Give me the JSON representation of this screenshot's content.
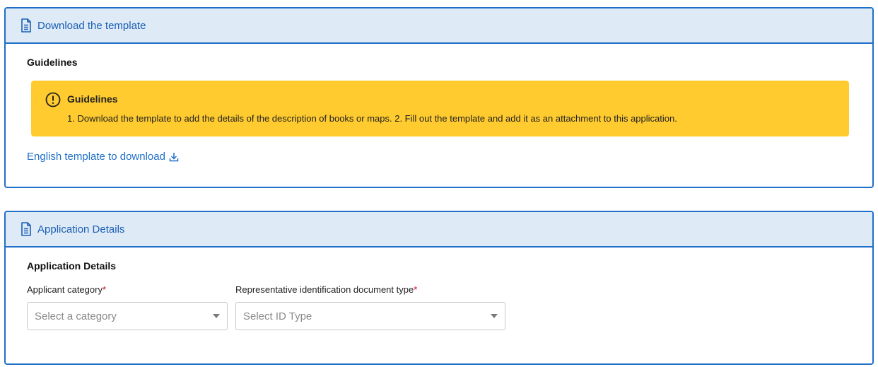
{
  "download_card": {
    "header_title": "Download the template",
    "header_icon": "document-icon",
    "section_title": "Guidelines",
    "alert": {
      "icon": "exclamation-circle-icon",
      "title": "Guidelines",
      "text": "1. Download the template to add the details of the description of books or maps. 2. Fill out the template and add it as an attachment to this application.",
      "color": "#ffcb2e"
    },
    "download_link": {
      "label": "English template to download",
      "icon": "download-icon"
    }
  },
  "application_card": {
    "header_title": "Application Details",
    "header_icon": "document-icon",
    "section_title": "Application Details",
    "fields": [
      {
        "label": "Applicant category",
        "required_mark": "*",
        "placeholder": "Select a category"
      },
      {
        "label": "Representative identification document type",
        "required_mark": "*",
        "placeholder": "Select ID Type"
      }
    ]
  },
  "colors": {
    "accent": "#1f6fc8",
    "header_bg": "#dfeaf7",
    "required": "#d0021b"
  }
}
